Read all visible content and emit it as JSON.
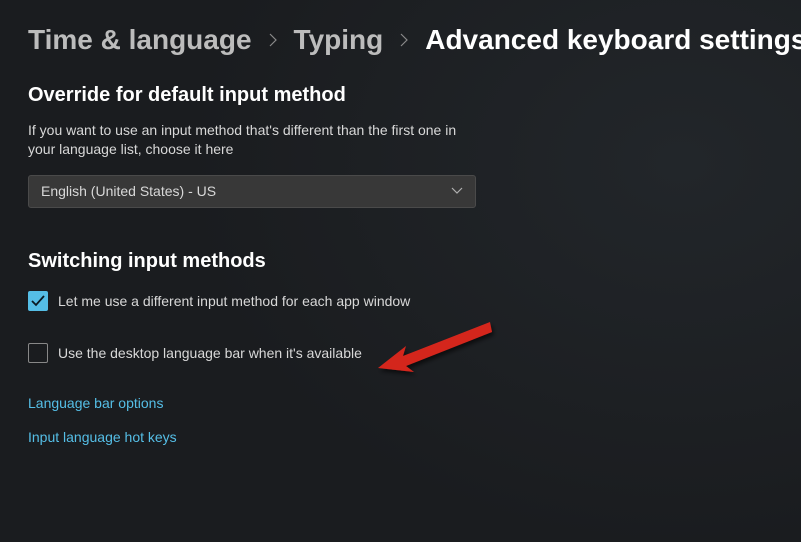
{
  "breadcrumb": {
    "level1": "Time & language",
    "level2": "Typing",
    "current": "Advanced keyboard settings"
  },
  "override_section": {
    "title": "Override for default input method",
    "description": "If you want to use an input method that's different than the first one in your language list, choose it here",
    "dropdown_value": "English (United States) - US"
  },
  "switching_section": {
    "title": "Switching input methods",
    "checkbox_per_app": {
      "label": "Let me use a different input method for each app window",
      "checked": true
    },
    "checkbox_language_bar": {
      "label": "Use the desktop language bar when it's available",
      "checked": false
    }
  },
  "links": {
    "language_bar_options": "Language bar options",
    "input_language_hot_keys": "Input language hot keys"
  },
  "colors": {
    "accent": "#55bee6",
    "link": "#55bee6",
    "bg": "#1a1c1f"
  }
}
